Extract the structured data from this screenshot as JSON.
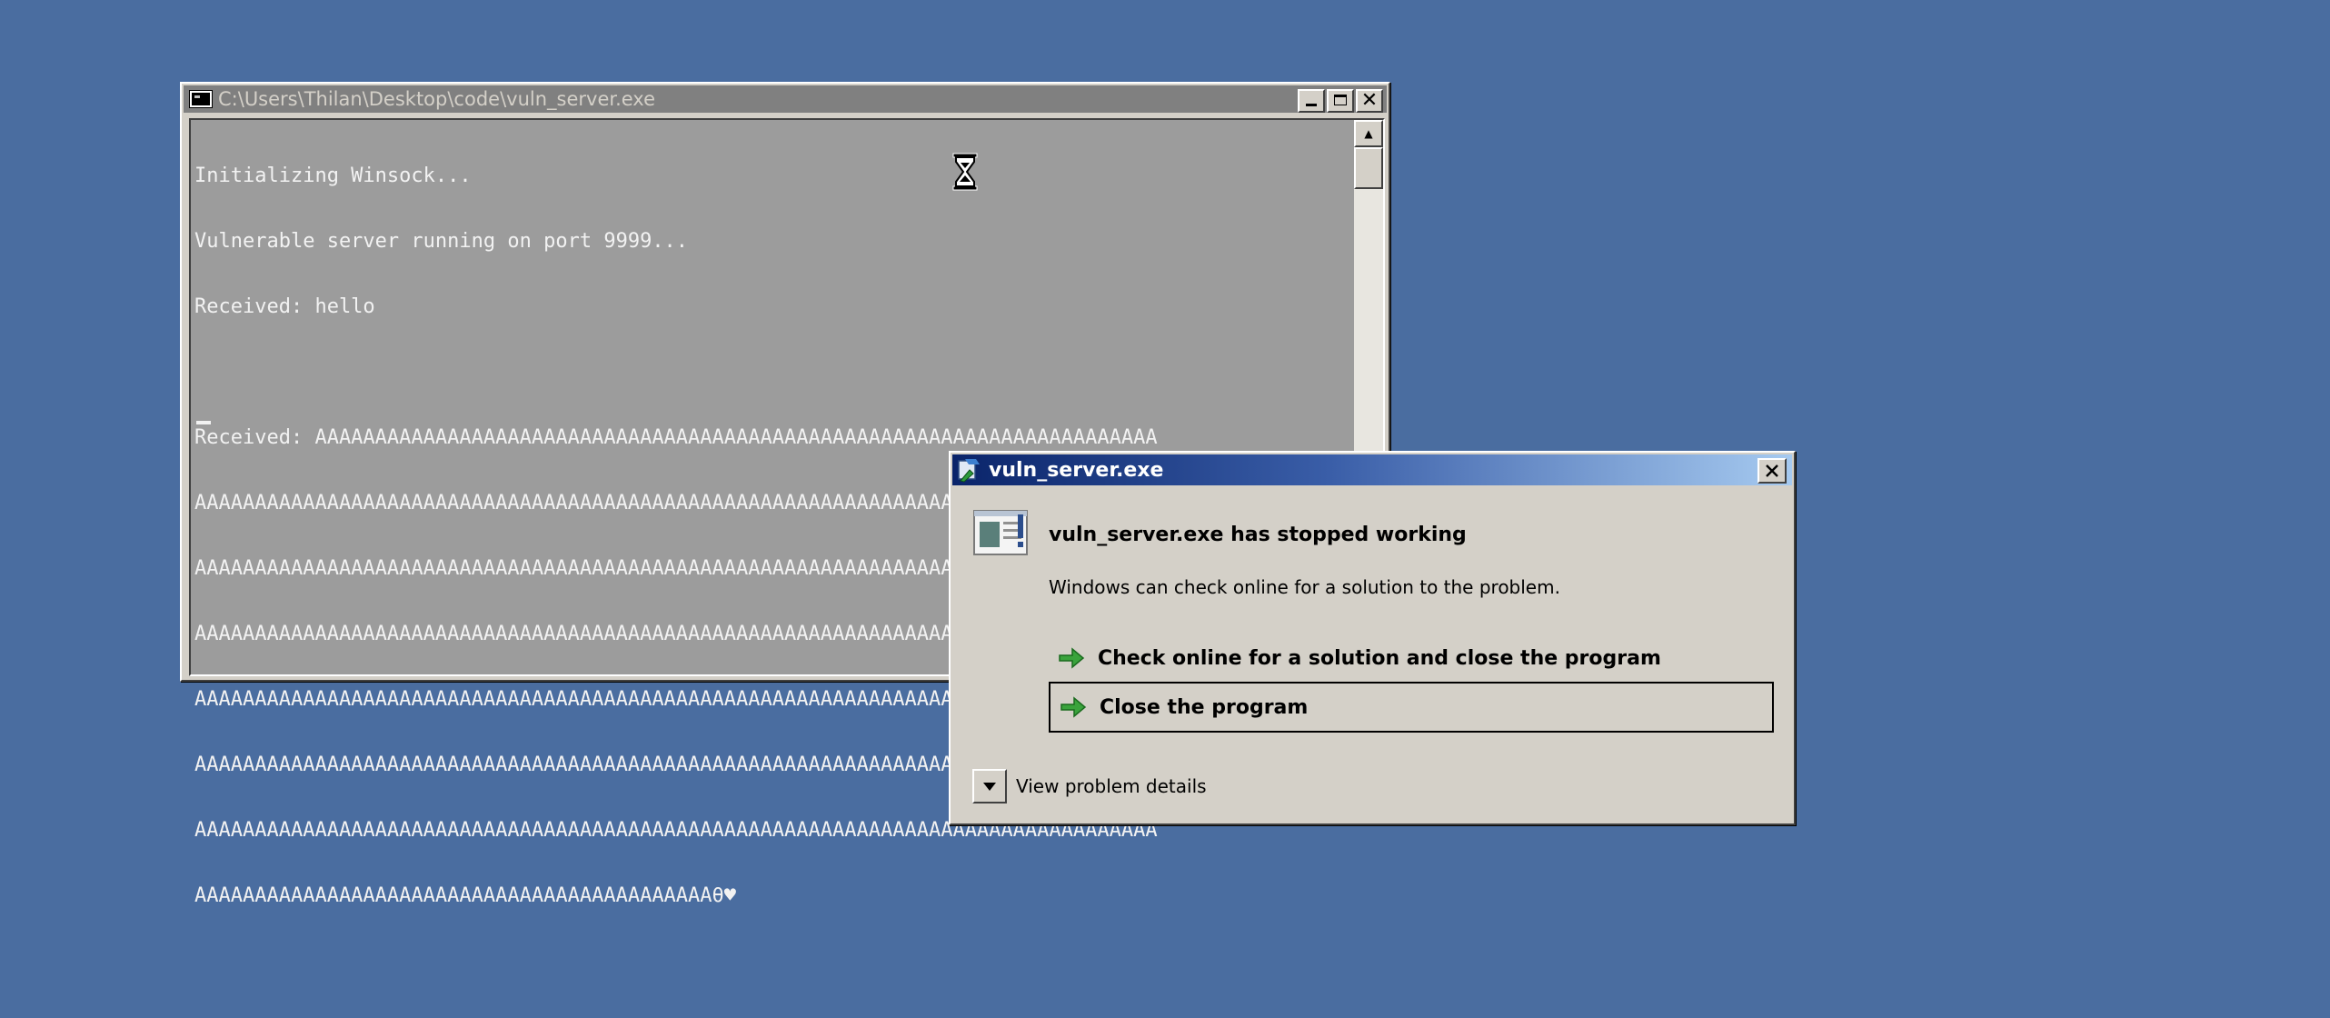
{
  "console": {
    "title": "C:\\Users\\Thilan\\Desktop\\code\\vuln_server.exe",
    "lines": [
      "Initializing Winsock...",
      "Vulnerable server running on port 9999...",
      "Received: hello",
      "",
      "Received: AAAAAAAAAAAAAAAAAAAAAAAAAAAAAAAAAAAAAAAAAAAAAAAAAAAAAAAAAAAAAAAAAAAAAA",
      "AAAAAAAAAAAAAAAAAAAAAAAAAAAAAAAAAAAAAAAAAAAAAAAAAAAAAAAAAAAAAAAAAAAAAAAAAAAAAAAA",
      "AAAAAAAAAAAAAAAAAAAAAAAAAAAAAAAAAAAAAAAAAAAAAAAAAAAAAAAAAAAAAAAAAAAAAAAAAAAAAAAA",
      "AAAAAAAAAAAAAAAAAAAAAAAAAAAAAAAAAAAAAAAAAAAAAAAAAAAAAAAAAAAAAAAAAAAAAAAAAAAAAAAA",
      "AAAAAAAAAAAAAAAAAAAAAAAAAAAAAAAAAAAAAAAAAAAAAAAAAAAAAAAAAAAAAAAAAAAAAAAAAAAAAAAA",
      "AAAAAAAAAAAAAAAAAAAAAAAAAAAAAAAAAAAAAAAAAAAAAAAAAAAAAAAAAAAAAAAAAAAAAAAAAAAAAAAA",
      "AAAAAAAAAAAAAAAAAAAAAAAAAAAAAAAAAAAAAAAAAAAAAAAAAAAAAAAAAAAAAAAAAAAAAAAAAAAAAAAA",
      "AAAAAAAAAAAAAAAAAAAAAAAAAAAAAAAAAAAAAAAAAAAθ♥"
    ],
    "background_color": "#9c9c9c",
    "text_color": "#f2f2f2"
  },
  "dialog": {
    "title": "vuln_server.exe",
    "heading": "vuln_server.exe has stopped working",
    "description": "Windows can check online for a solution to the problem.",
    "options": [
      {
        "label": "Check online for a solution and close the program",
        "icon": "green-arrow-icon"
      },
      {
        "label": "Close the program",
        "icon": "green-arrow-icon"
      }
    ],
    "details_label": "View problem details",
    "titlebar_gradient": [
      "#0a246a",
      "#a6caf0"
    ]
  },
  "desktop": {
    "background_color": "#4a6da0"
  }
}
